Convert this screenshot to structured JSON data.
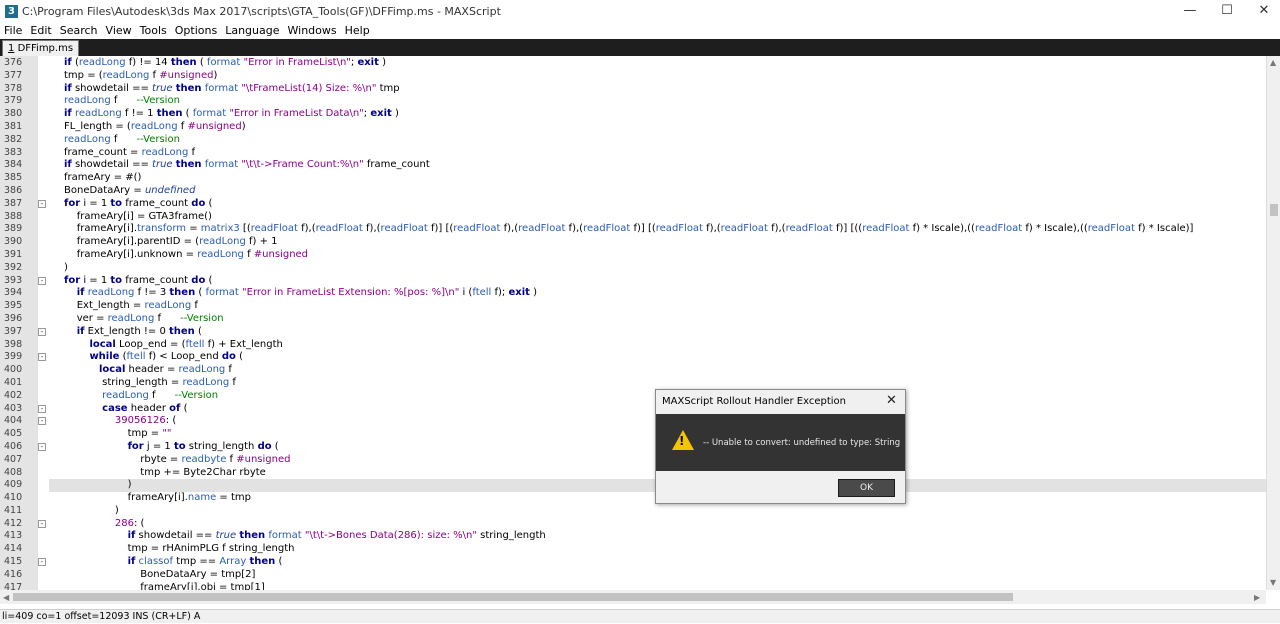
{
  "window": {
    "title": "C:\\Program Files\\Autodesk\\3ds Max 2017\\scripts\\GTA_Tools(GF)\\DFFimp.ms - MAXScript",
    "minimize": "—",
    "maximize": "☐",
    "close": "✕"
  },
  "menu": [
    "File",
    "Edit",
    "Search",
    "View",
    "Tools",
    "Options",
    "Language",
    "Windows",
    "Help"
  ],
  "tab": {
    "index": "1",
    "name": "DFFimp.ms"
  },
  "code": [
    {
      "n": "376",
      "fold": "",
      "tokens": [
        [
          "kw",
          "if"
        ],
        [
          "p",
          " ("
        ],
        [
          "fn",
          "readLong"
        ],
        [
          "p",
          " f) != 14 "
        ],
        [
          "kw",
          "then"
        ],
        [
          "p",
          " ( "
        ],
        [
          "fn",
          "format"
        ],
        [
          "p",
          " "
        ],
        [
          "str",
          "\"Error in FrameList\\n\""
        ],
        [
          "p",
          "; "
        ],
        [
          "kw",
          "exit"
        ],
        [
          "p",
          " )"
        ]
      ]
    },
    {
      "n": "377",
      "fold": "",
      "tokens": [
        [
          "p",
          "tmp = ("
        ],
        [
          "fn",
          "readLong"
        ],
        [
          "p",
          " f "
        ],
        [
          "nm",
          "#unsigned"
        ],
        [
          "p",
          ")"
        ]
      ]
    },
    {
      "n": "378",
      "fold": "",
      "tokens": [
        [
          "kw",
          "if"
        ],
        [
          "p",
          " showdetail == "
        ],
        [
          "it",
          "true"
        ],
        [
          "p",
          " "
        ],
        [
          "kw",
          "then"
        ],
        [
          "p",
          " "
        ],
        [
          "fn",
          "format"
        ],
        [
          "p",
          " "
        ],
        [
          "str",
          "\"\\tFrameList(14) Size: %\\n\""
        ],
        [
          "p",
          " tmp"
        ]
      ]
    },
    {
      "n": "379",
      "fold": "",
      "tokens": [
        [
          "fn",
          "readLong"
        ],
        [
          "p",
          " f      "
        ],
        [
          "cm",
          "--Version"
        ]
      ]
    },
    {
      "n": "380",
      "fold": "",
      "tokens": [
        [
          "kw",
          "if"
        ],
        [
          "p",
          " "
        ],
        [
          "fn",
          "readLong"
        ],
        [
          "p",
          " f != 1 "
        ],
        [
          "kw",
          "then"
        ],
        [
          "p",
          " ( "
        ],
        [
          "fn",
          "format"
        ],
        [
          "p",
          " "
        ],
        [
          "str",
          "\"Error in FrameList Data\\n\""
        ],
        [
          "p",
          "; "
        ],
        [
          "kw",
          "exit"
        ],
        [
          "p",
          " )"
        ]
      ]
    },
    {
      "n": "381",
      "fold": "",
      "tokens": [
        [
          "p",
          "FL_length = ("
        ],
        [
          "fn",
          "readLong"
        ],
        [
          "p",
          " f "
        ],
        [
          "nm",
          "#unsigned"
        ],
        [
          "p",
          ")"
        ]
      ]
    },
    {
      "n": "382",
      "fold": "",
      "tokens": [
        [
          "fn",
          "readLong"
        ],
        [
          "p",
          " f      "
        ],
        [
          "cm",
          "--Version"
        ]
      ]
    },
    {
      "n": "383",
      "fold": "",
      "tokens": [
        [
          "p",
          "frame_count = "
        ],
        [
          "fn",
          "readLong"
        ],
        [
          "p",
          " f"
        ]
      ]
    },
    {
      "n": "384",
      "fold": "",
      "tokens": [
        [
          "kw",
          "if"
        ],
        [
          "p",
          " showdetail == "
        ],
        [
          "it",
          "true"
        ],
        [
          "p",
          " "
        ],
        [
          "kw",
          "then"
        ],
        [
          "p",
          " "
        ],
        [
          "fn",
          "format"
        ],
        [
          "p",
          " "
        ],
        [
          "str",
          "\"\\t\\t->Frame Count:%\\n\""
        ],
        [
          "p",
          " frame_count"
        ]
      ]
    },
    {
      "n": "385",
      "fold": "",
      "tokens": [
        [
          "p",
          "frameAry = #()"
        ]
      ]
    },
    {
      "n": "386",
      "fold": "",
      "tokens": [
        [
          "p",
          "BoneDataAry = "
        ],
        [
          "it",
          "undefined"
        ]
      ]
    },
    {
      "n": "387",
      "fold": "⊟",
      "tokens": [
        [
          "kw",
          "for"
        ],
        [
          "p",
          " i = 1 "
        ],
        [
          "kw",
          "to"
        ],
        [
          "p",
          " frame_count "
        ],
        [
          "kw",
          "do"
        ],
        [
          "p",
          " ("
        ]
      ]
    },
    {
      "n": "388",
      "fold": "",
      "tokens": [
        [
          "p",
          "    frameAry[i] = GTA3frame()"
        ]
      ]
    },
    {
      "n": "389",
      "fold": "",
      "tokens": [
        [
          "p",
          "    frameAry[i]."
        ],
        [
          "fn",
          "transform"
        ],
        [
          "p",
          " = "
        ],
        [
          "fn",
          "matrix3"
        ],
        [
          "p",
          " [("
        ],
        [
          "fn",
          "readFloat"
        ],
        [
          "p",
          " f),("
        ],
        [
          "fn",
          "readFloat"
        ],
        [
          "p",
          " f),("
        ],
        [
          "fn",
          "readFloat"
        ],
        [
          "p",
          " f)] [("
        ],
        [
          "fn",
          "readFloat"
        ],
        [
          "p",
          " f),("
        ],
        [
          "fn",
          "readFloat"
        ],
        [
          "p",
          " f),("
        ],
        [
          "fn",
          "readFloat"
        ],
        [
          "p",
          " f)] [("
        ],
        [
          "fn",
          "readFloat"
        ],
        [
          "p",
          " f),("
        ],
        [
          "fn",
          "readFloat"
        ],
        [
          "p",
          " f),("
        ],
        [
          "fn",
          "readFloat"
        ],
        [
          "p",
          " f)] [(("
        ],
        [
          "fn",
          "readFloat"
        ],
        [
          "p",
          " f) * Iscale),(("
        ],
        [
          "fn",
          "readFloat"
        ],
        [
          "p",
          " f) * Iscale),(("
        ],
        [
          "fn",
          "readFloat"
        ],
        [
          "p",
          " f) * Iscale)]"
        ]
      ]
    },
    {
      "n": "390",
      "fold": "",
      "tokens": [
        [
          "p",
          "    frameAry[i].parentID = ("
        ],
        [
          "fn",
          "readLong"
        ],
        [
          "p",
          " f) + 1"
        ]
      ]
    },
    {
      "n": "391",
      "fold": "",
      "tokens": [
        [
          "p",
          "    frameAry[i].unknown = "
        ],
        [
          "fn",
          "readLong"
        ],
        [
          "p",
          " f "
        ],
        [
          "nm",
          "#unsigned"
        ]
      ]
    },
    {
      "n": "392",
      "fold": "",
      "tokens": [
        [
          "p",
          ")"
        ]
      ]
    },
    {
      "n": "393",
      "fold": "⊟",
      "tokens": [
        [
          "kw",
          "for"
        ],
        [
          "p",
          " i = 1 "
        ],
        [
          "kw",
          "to"
        ],
        [
          "p",
          " frame_count "
        ],
        [
          "kw",
          "do"
        ],
        [
          "p",
          " ("
        ]
      ]
    },
    {
      "n": "394",
      "fold": "",
      "tokens": [
        [
          "p",
          "    "
        ],
        [
          "kw",
          "if"
        ],
        [
          "p",
          " "
        ],
        [
          "fn",
          "readLong"
        ],
        [
          "p",
          " f != 3 "
        ],
        [
          "kw",
          "then"
        ],
        [
          "p",
          " ( "
        ],
        [
          "fn",
          "format"
        ],
        [
          "p",
          " "
        ],
        [
          "str",
          "\"Error in FrameList Extension: %[pos: %]\\n\""
        ],
        [
          "p",
          " i ("
        ],
        [
          "fn",
          "ftell"
        ],
        [
          "p",
          " f); "
        ],
        [
          "kw",
          "exit"
        ],
        [
          "p",
          " )"
        ]
      ]
    },
    {
      "n": "395",
      "fold": "",
      "tokens": [
        [
          "p",
          "    Ext_length = "
        ],
        [
          "fn",
          "readLong"
        ],
        [
          "p",
          " f"
        ]
      ]
    },
    {
      "n": "396",
      "fold": "",
      "tokens": [
        [
          "p",
          "    ver = "
        ],
        [
          "fn",
          "readLong"
        ],
        [
          "p",
          " f      "
        ],
        [
          "cm",
          "--Version"
        ]
      ]
    },
    {
      "n": "397",
      "fold": "⊟",
      "tokens": [
        [
          "p",
          "    "
        ],
        [
          "kw",
          "if"
        ],
        [
          "p",
          " Ext_length != 0 "
        ],
        [
          "kw",
          "then"
        ],
        [
          "p",
          " ("
        ]
      ]
    },
    {
      "n": "398",
      "fold": "",
      "tokens": [
        [
          "p",
          "        "
        ],
        [
          "kw",
          "local"
        ],
        [
          "p",
          " Loop_end = ("
        ],
        [
          "fn",
          "ftell"
        ],
        [
          "p",
          " f) + Ext_length"
        ]
      ]
    },
    {
      "n": "399",
      "fold": "⊟",
      "tokens": [
        [
          "p",
          "        "
        ],
        [
          "kw",
          "while"
        ],
        [
          "p",
          " ("
        ],
        [
          "fn",
          "ftell"
        ],
        [
          "p",
          " f) < Loop_end "
        ],
        [
          "kw",
          "do"
        ],
        [
          "p",
          " ("
        ]
      ]
    },
    {
      "n": "400",
      "fold": "",
      "tokens": [
        [
          "p",
          "           "
        ],
        [
          "kw",
          "local"
        ],
        [
          "p",
          " header = "
        ],
        [
          "fn",
          "readLong"
        ],
        [
          "p",
          " f"
        ]
      ]
    },
    {
      "n": "401",
      "fold": "",
      "tokens": [
        [
          "p",
          "            string_length = "
        ],
        [
          "fn",
          "readLong"
        ],
        [
          "p",
          " f"
        ]
      ]
    },
    {
      "n": "402",
      "fold": "",
      "tokens": [
        [
          "p",
          "            "
        ],
        [
          "fn",
          "readLong"
        ],
        [
          "p",
          " f      "
        ],
        [
          "cm",
          "--Version"
        ]
      ]
    },
    {
      "n": "403",
      "fold": "⊟",
      "tokens": [
        [
          "p",
          "            "
        ],
        [
          "kw",
          "case"
        ],
        [
          "p",
          " header "
        ],
        [
          "kw",
          "of"
        ],
        [
          "p",
          " ("
        ]
      ]
    },
    {
      "n": "404",
      "fold": "⊟",
      "tokens": [
        [
          "p",
          "                "
        ],
        [
          "nm",
          "39056126"
        ],
        [
          "p",
          ": ("
        ]
      ]
    },
    {
      "n": "405",
      "fold": "",
      "tokens": [
        [
          "p",
          "                    tmp = "
        ],
        [
          "str",
          "\"\""
        ]
      ]
    },
    {
      "n": "406",
      "fold": "⊟",
      "tokens": [
        [
          "p",
          "                    "
        ],
        [
          "kw",
          "for"
        ],
        [
          "p",
          " j = 1 "
        ],
        [
          "kw",
          "to"
        ],
        [
          "p",
          " string_length "
        ],
        [
          "kw",
          "do"
        ],
        [
          "p",
          " ("
        ]
      ]
    },
    {
      "n": "407",
      "fold": "",
      "tokens": [
        [
          "p",
          "                        rbyte = "
        ],
        [
          "fn",
          "readbyte"
        ],
        [
          "p",
          " f "
        ],
        [
          "nm",
          "#unsigned"
        ]
      ]
    },
    {
      "n": "408",
      "fold": "",
      "tokens": [
        [
          "p",
          "                        tmp += Byte2Char rbyte"
        ]
      ]
    },
    {
      "n": "409",
      "fold": "",
      "hl": true,
      "tokens": [
        [
          "p",
          "                    )"
        ]
      ]
    },
    {
      "n": "410",
      "fold": "",
      "tokens": [
        [
          "p",
          "                    frameAry[i]."
        ],
        [
          "fn",
          "name"
        ],
        [
          "p",
          " = tmp"
        ]
      ]
    },
    {
      "n": "411",
      "fold": "",
      "tokens": [
        [
          "p",
          "                )"
        ]
      ]
    },
    {
      "n": "412",
      "fold": "⊟",
      "tokens": [
        [
          "p",
          "                "
        ],
        [
          "nm",
          "286"
        ],
        [
          "p",
          ": ("
        ]
      ]
    },
    {
      "n": "413",
      "fold": "",
      "tokens": [
        [
          "p",
          "                    "
        ],
        [
          "kw",
          "if"
        ],
        [
          "p",
          " showdetail == "
        ],
        [
          "it",
          "true"
        ],
        [
          "p",
          " "
        ],
        [
          "kw",
          "then"
        ],
        [
          "p",
          " "
        ],
        [
          "fn",
          "format"
        ],
        [
          "p",
          " "
        ],
        [
          "str",
          "\"\\t\\t->Bones Data(286): size: %\\n\""
        ],
        [
          "p",
          " string_length"
        ]
      ]
    },
    {
      "n": "414",
      "fold": "",
      "tokens": [
        [
          "p",
          "                    tmp = rHAnimPLG f string_length"
        ]
      ]
    },
    {
      "n": "415",
      "fold": "⊟",
      "tokens": [
        [
          "p",
          "                    "
        ],
        [
          "kw",
          "if"
        ],
        [
          "p",
          " "
        ],
        [
          "fn",
          "classof"
        ],
        [
          "p",
          " tmp == "
        ],
        [
          "fn",
          "Array"
        ],
        [
          "p",
          " "
        ],
        [
          "kw",
          "then"
        ],
        [
          "p",
          " ("
        ]
      ]
    },
    {
      "n": "416",
      "fold": "",
      "tokens": [
        [
          "p",
          "                        BoneDataAry = tmp[2]"
        ]
      ]
    },
    {
      "n": "417",
      "fold": "",
      "tokens": [
        [
          "p",
          "                        frameAry[i].obj = tmp[1]"
        ]
      ]
    }
  ],
  "status": "li=409 co=1 offset=12093 INS (CR+LF) A",
  "dialog": {
    "title": "MAXScript Rollout Handler Exception",
    "message": "-- Unable to convert: undefined to type: String",
    "ok": "OK",
    "close": "✕"
  }
}
